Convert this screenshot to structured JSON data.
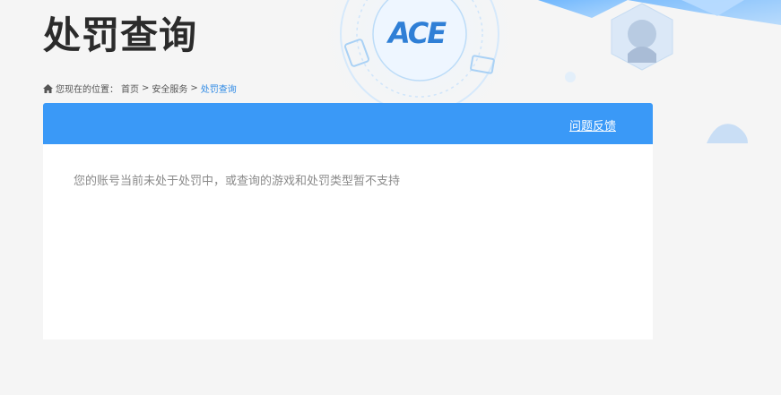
{
  "header": {
    "title": "处罚查询",
    "emblem_text": "ACE"
  },
  "breadcrumb": {
    "prefix": "您现在的位置：",
    "items": [
      "首页",
      "安全服务",
      "处罚查询"
    ],
    "separator": ">"
  },
  "panel": {
    "feedback_label": "问题反馈",
    "notice": "您的账号当前未处于处罚中，或查询的游戏和处罚类型暂不支持"
  },
  "colors": {
    "accent": "#3a99f7",
    "breadcrumb_current": "#2f8ae5",
    "page_background": "#f5f5f5"
  },
  "icons": [
    "home-icon"
  ]
}
